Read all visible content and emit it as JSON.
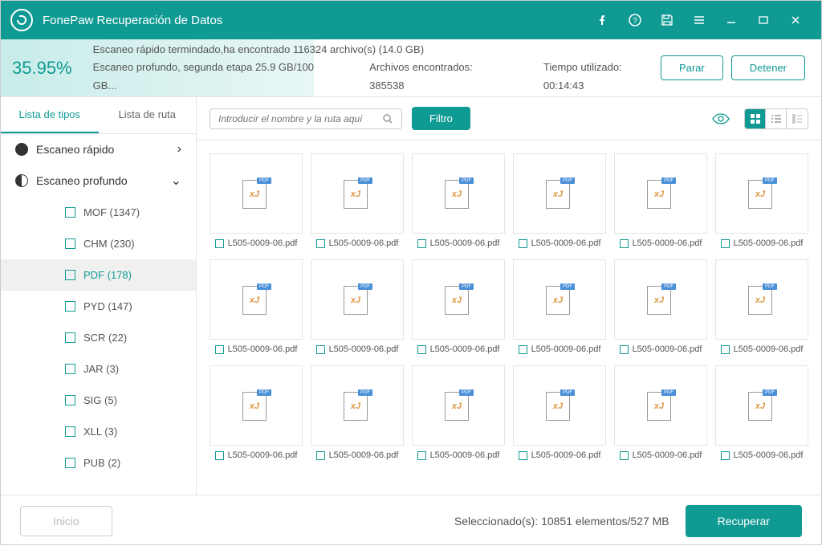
{
  "app_title": "FonePaw Recuperación de Datos",
  "progress_pct": "35.95%",
  "scan_msg1": "Escaneo rápido termindado,ha encontrado 116324 archivo(s) (14.0 GB)",
  "scan_msg2": "Escaneo profundo, segunda etapa 25.9 GB/100 GB...",
  "files_found": "Archivos encontrados: 385538",
  "time_used": "Tiempo utilizado: 00:14:43",
  "btn_pause": "Parar",
  "btn_stop": "Detener",
  "tabs": {
    "types": "Lista de tipos",
    "path": "Lista de ruta"
  },
  "tree": {
    "quick": "Escaneo rápido",
    "deep": "Escaneo profundo",
    "items": [
      {
        "label": "MOF (1347)"
      },
      {
        "label": "CHM (230)"
      },
      {
        "label": "PDF (178)"
      },
      {
        "label": "PYD (147)"
      },
      {
        "label": "SCR (22)"
      },
      {
        "label": "JAR (3)"
      },
      {
        "label": "SIG (5)"
      },
      {
        "label": "XLL (3)"
      },
      {
        "label": "PUB (2)"
      }
    ]
  },
  "search_placeholder": "Introducir el nombre y la ruta aquí",
  "btn_filter": "Filtro",
  "file_name": "L505-0009-06.pdf",
  "selected_text": "Seleccionado(s): 10851 elementos/527 MB",
  "btn_home": "Inicio",
  "btn_recover": "Recuperar"
}
